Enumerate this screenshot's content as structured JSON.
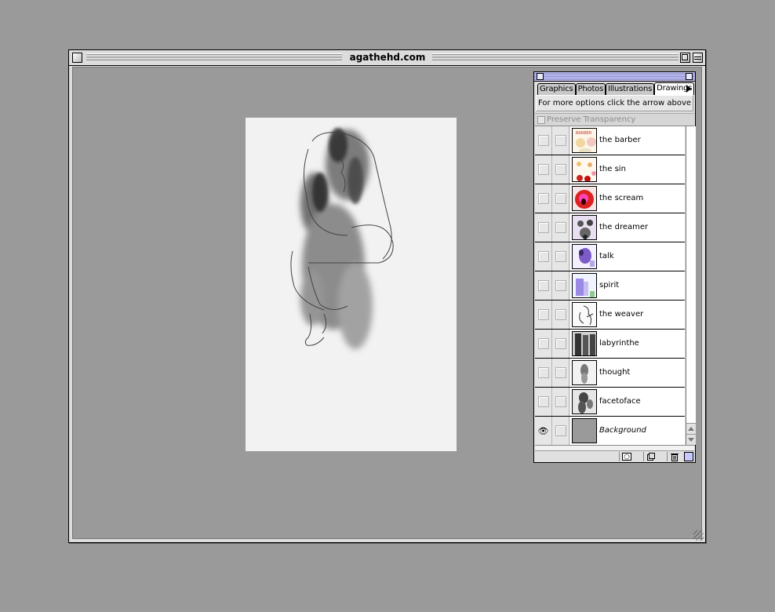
{
  "window": {
    "title": "agathehd.com"
  },
  "palette": {
    "tabs": [
      {
        "label": "Graphics",
        "active": false
      },
      {
        "label": "Photos",
        "active": false
      },
      {
        "label": "Illustrations",
        "active": false
      },
      {
        "label": "Drawings",
        "active": true
      }
    ],
    "info_text": "For more options click the arrow above",
    "preserve_transparency": {
      "label": "Preserve Transparency",
      "checked": false,
      "enabled": false
    },
    "layers": [
      {
        "name": "the barber",
        "visible": false,
        "thumb": "thumb-barber"
      },
      {
        "name": "the sin",
        "visible": false,
        "thumb": "thumb-sin"
      },
      {
        "name": "the scream",
        "visible": false,
        "thumb": "thumb-scream"
      },
      {
        "name": "the dreamer",
        "visible": false,
        "thumb": "thumb-dreamer"
      },
      {
        "name": "talk",
        "visible": false,
        "thumb": "thumb-talk"
      },
      {
        "name": "spirit",
        "visible": false,
        "thumb": "thumb-spirit"
      },
      {
        "name": "the weaver",
        "visible": false,
        "thumb": "thumb-weaver"
      },
      {
        "name": "labyrinthe",
        "visible": false,
        "thumb": "thumb-labyrinthe"
      },
      {
        "name": "thought",
        "visible": false,
        "thumb": "thumb-thought"
      },
      {
        "name": "facetoface",
        "visible": false,
        "thumb": "thumb-facetoface"
      },
      {
        "name": "Background",
        "visible": true,
        "thumb": "thumb-background"
      }
    ]
  },
  "colors": {
    "desktop": "#9a9a9a",
    "window_chrome": "#dcdcdc",
    "palette_title": "#8f8fc8",
    "active_tab": "#ffffff"
  }
}
